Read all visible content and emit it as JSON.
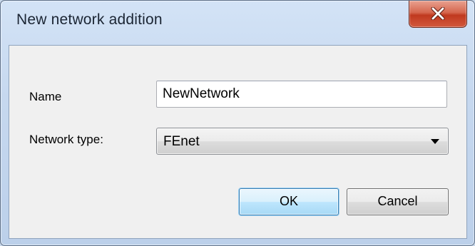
{
  "window": {
    "title": "New network addition",
    "close_icon": "close-icon"
  },
  "form": {
    "name_label": "Name",
    "name_value": "NewNetwork",
    "type_label": "Network type:",
    "type_value": "FEnet",
    "type_arrow_icon": "chevron-down-icon"
  },
  "buttons": {
    "ok_label": "OK",
    "cancel_label": "Cancel"
  },
  "colors": {
    "close_button": "#c7432a",
    "default_button_border": "#3c7fb1",
    "client_background": "#f0f0f0"
  }
}
